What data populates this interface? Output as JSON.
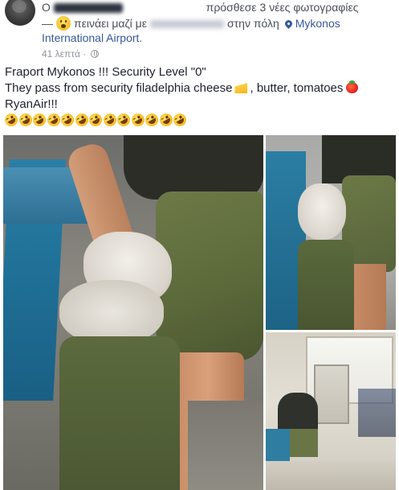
{
  "header": {
    "line1_prefix": "Ο",
    "line1_action": "πρόσθεσε 3 νέες φωτογραφίες",
    "line2_prefix": "—",
    "line2_activity": "πεινάει μαζί με",
    "line2_location_prefix": "στην πόλη",
    "line2_location": "Mykonos",
    "line3_place": "International Airport.",
    "timestamp": "41 λεπτά",
    "timestamp_separator": "·",
    "privacy_icon": "globe-icon"
  },
  "post": {
    "line1": "Fraport Mykonos !!! Security Level \"0\"",
    "line2_part1": "They pass from security filadelphia cheese",
    "line2_part2": ", butter, tomatoes",
    "line3": "RyanAir!!!",
    "rofl_count": 13,
    "emoji_names": [
      "hungry-face-emoji",
      "cheese-emoji",
      "tomato-emoji",
      "rolling-on-floor-laughing-emoji"
    ]
  },
  "photos": [
    {
      "name": "photo-main",
      "description_icon": "photo"
    },
    {
      "name": "photo-top-right",
      "description_icon": "photo"
    },
    {
      "name": "photo-bottom-right",
      "description_icon": "photo"
    }
  ],
  "colors": {
    "link": "#365899",
    "text": "#1d2129",
    "meta": "#90949c",
    "secondary": "#4b4f56"
  }
}
